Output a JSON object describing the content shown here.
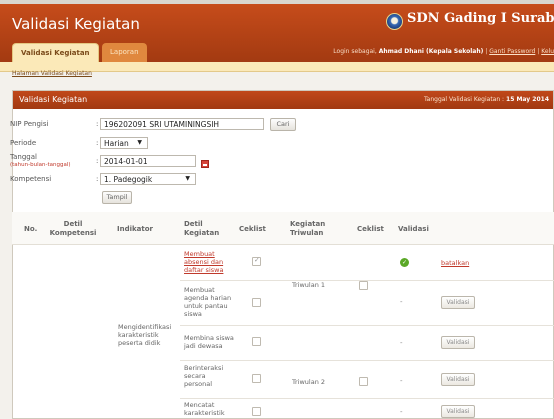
{
  "app_title": "Validasi Kegiatan",
  "school_name": "SDN Gading I Surabaya",
  "tabs": [
    {
      "label": "Validasi Kegiatan",
      "active": true
    },
    {
      "label": "Laporan",
      "active": false
    }
  ],
  "login": {
    "prefix": "Login sebagai,",
    "user": "Ahmad Dhani (Kepala Sekolah)",
    "sep1": "|",
    "change_password": "Ganti Password",
    "sep2": "|",
    "logout": "Kelu"
  },
  "breadcrumb": "Halaman Validasi Kegiatan",
  "panel": {
    "title": "Validasi Kegiatan",
    "date_label": "Tanggal Validasi Kegiatan :",
    "date_value": "15 May 2014"
  },
  "form": {
    "nip_label": "NIP Pengisi",
    "nip_value": "196202091 SRI UTAMININGSIH",
    "cari_label": "Cari",
    "periode_label": "Periode",
    "periode_value": "Harian",
    "tanggal_label": "Tanggal",
    "tanggal_hint": "(tahun-bulan-tanggal)",
    "tanggal_value": "2014-01-01",
    "kompetensi_label": "Kompetensi",
    "kompetensi_value": "1. Padegogik",
    "tampil_label": "Tampil",
    "colon": ":"
  },
  "table": {
    "headers": {
      "no": "No.",
      "detil_kompetensi": "Detil Kompetensi",
      "indikator": "Indikator",
      "detil_kegiatan": "Detil Kegiatan",
      "ceklist": "Ceklist",
      "kegiatan_triwulan": "Kegiatan Triwulan",
      "ceklist2": "Ceklist",
      "validasi": "Validasi"
    },
    "indikator": "Mengidentifikasi karakteristik peserta didik",
    "triwulan": [
      "Triwulan 1",
      "Triwulan 2"
    ],
    "rows": [
      {
        "kegiatan": "Membuat absensi dan daftar siswa",
        "checked": true,
        "validated": true,
        "action": "batalkan"
      },
      {
        "kegiatan": "Membuat agenda harian untuk pantau siswa",
        "checked": false,
        "validated": false,
        "dash": "-",
        "action": "Validasi"
      },
      {
        "kegiatan": "Membina siswa jadi dewasa",
        "checked": false,
        "validated": false,
        "dash": "-",
        "action": "Validasi"
      },
      {
        "kegiatan": "Berinteraksi secara personal",
        "checked": false,
        "validated": false,
        "dash": "-",
        "action": "Validasi"
      },
      {
        "kegiatan": "Mencatat karakteristik",
        "checked": false,
        "validated": false,
        "dash": "-",
        "action": "Validasi"
      }
    ]
  },
  "colors": {
    "header": "#b8461a",
    "tab_active": "#fbe9b8",
    "link": "#c0392b",
    "ok": "#5aa827"
  }
}
